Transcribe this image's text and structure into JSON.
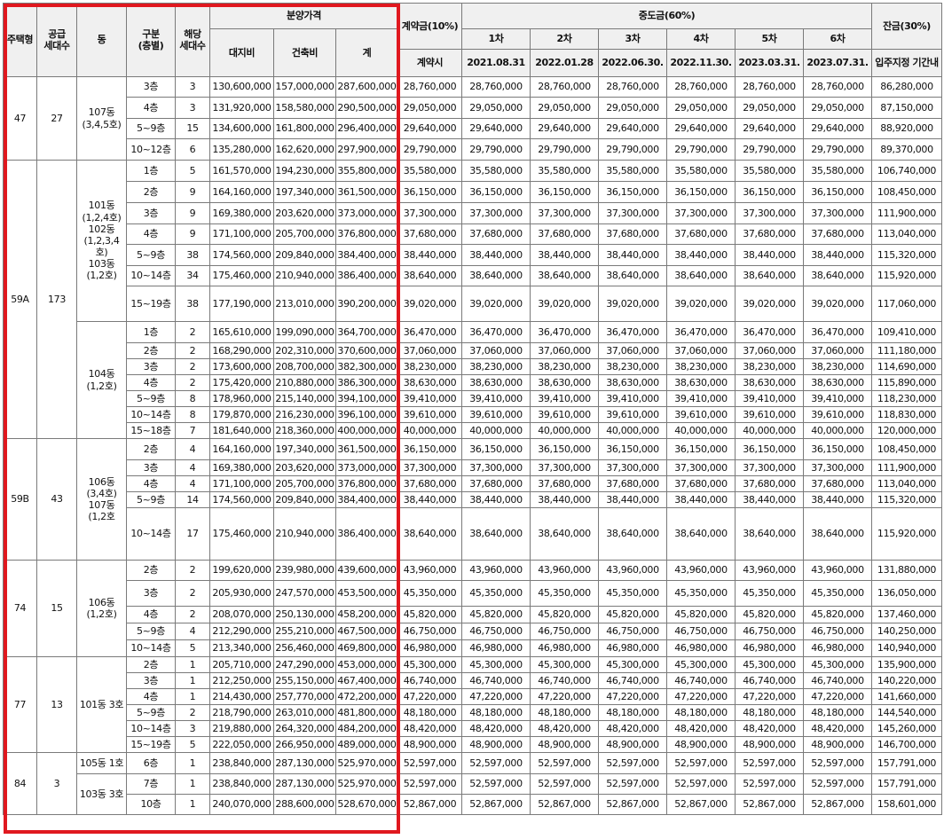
{
  "header": {
    "type": "주택형",
    "supply": "공급\n세대수",
    "dong": "동",
    "floor": "구분\n(층별)",
    "units": "해당\n세대수",
    "sale_price": "분양가격",
    "land": "대지비",
    "building": "건축비",
    "total": "계",
    "deposit": "계약금(10%)",
    "deposit_sub": "계약시",
    "middle": "중도금(60%)",
    "middle_cols": [
      {
        "label": "1차",
        "date": "2021.08.31"
      },
      {
        "label": "2차",
        "date": "2022.01.28"
      },
      {
        "label": "3차",
        "date": "2022.06.30."
      },
      {
        "label": "4차",
        "date": "2022.11.30."
      },
      {
        "label": "5차",
        "date": "2023.03.31."
      },
      {
        "label": "6차",
        "date": "2023.07.31."
      }
    ],
    "balance": "잔금(30%)",
    "balance_sub": "입주지정 기간내"
  },
  "groups": [
    {
      "type": "47",
      "supply": "27",
      "dongs": [
        {
          "label": "107동\n(3,4,5호)",
          "rows": [
            {
              "floor": "3층",
              "units": "3",
              "land": "130,600,000",
              "building": "157,000,000",
              "total": "287,600,000",
              "deposit": "28,760,000",
              "middle": "28,760,000",
              "balance": "86,280,000"
            },
            {
              "floor": "4층",
              "units": "3",
              "land": "131,920,000",
              "building": "158,580,000",
              "total": "290,500,000",
              "deposit": "29,050,000",
              "middle": "29,050,000",
              "balance": "87,150,000"
            },
            {
              "floor": "5~9층",
              "units": "15",
              "land": "134,600,000",
              "building": "161,800,000",
              "total": "296,400,000",
              "deposit": "29,640,000",
              "middle": "29,640,000",
              "balance": "88,920,000"
            },
            {
              "floor": "10~12층",
              "units": "6",
              "land": "135,280,000",
              "building": "162,620,000",
              "total": "297,900,000",
              "deposit": "29,790,000",
              "middle": "29,790,000",
              "balance": "89,370,000"
            }
          ]
        }
      ]
    },
    {
      "type": "59A",
      "supply": "173",
      "dongs": [
        {
          "label": "101동\n(1,2,4호)\n102동\n(1,2,3,4\n호)\n103동\n(1,2호)",
          "rows": [
            {
              "floor": "1층",
              "units": "5",
              "land": "161,570,000",
              "building": "194,230,000",
              "total": "355,800,000",
              "deposit": "35,580,000",
              "middle": "35,580,000",
              "balance": "106,740,000"
            },
            {
              "floor": "2층",
              "units": "9",
              "land": "164,160,000",
              "building": "197,340,000",
              "total": "361,500,000",
              "deposit": "36,150,000",
              "middle": "36,150,000",
              "balance": "108,450,000"
            },
            {
              "floor": "3층",
              "units": "9",
              "land": "169,380,000",
              "building": "203,620,000",
              "total": "373,000,000",
              "deposit": "37,300,000",
              "middle": "37,300,000",
              "balance": "111,900,000"
            },
            {
              "floor": "4층",
              "units": "9",
              "land": "171,100,000",
              "building": "205,700,000",
              "total": "376,800,000",
              "deposit": "37,680,000",
              "middle": "37,680,000",
              "balance": "113,040,000"
            },
            {
              "floor": "5~9층",
              "units": "38",
              "land": "174,560,000",
              "building": "209,840,000",
              "total": "384,400,000",
              "deposit": "38,440,000",
              "middle": "38,440,000",
              "balance": "115,320,000"
            },
            {
              "floor": "10~14층",
              "units": "34",
              "land": "175,460,000",
              "building": "210,940,000",
              "total": "386,400,000",
              "deposit": "38,640,000",
              "middle": "38,640,000",
              "balance": "115,920,000"
            },
            {
              "floor": "15~19층",
              "units": "38",
              "land": "177,190,000",
              "building": "213,010,000",
              "total": "390,200,000",
              "deposit": "39,020,000",
              "middle": "39,020,000",
              "balance": "117,060,000"
            }
          ]
        },
        {
          "label": "104동\n(1,2호)",
          "rows": [
            {
              "floor": "1층",
              "units": "2",
              "land": "165,610,000",
              "building": "199,090,000",
              "total": "364,700,000",
              "deposit": "36,470,000",
              "middle": "36,470,000",
              "balance": "109,410,000"
            },
            {
              "floor": "2층",
              "units": "2",
              "land": "168,290,000",
              "building": "202,310,000",
              "total": "370,600,000",
              "deposit": "37,060,000",
              "middle": "37,060,000",
              "balance": "111,180,000"
            },
            {
              "floor": "3층",
              "units": "2",
              "land": "173,600,000",
              "building": "208,700,000",
              "total": "382,300,000",
              "deposit": "38,230,000",
              "middle": "38,230,000",
              "balance": "114,690,000"
            },
            {
              "floor": "4층",
              "units": "2",
              "land": "175,420,000",
              "building": "210,880,000",
              "total": "386,300,000",
              "deposit": "38,630,000",
              "middle": "38,630,000",
              "balance": "115,890,000"
            },
            {
              "floor": "5~9층",
              "units": "8",
              "land": "178,960,000",
              "building": "215,140,000",
              "total": "394,100,000",
              "deposit": "39,410,000",
              "middle": "39,410,000",
              "balance": "118,230,000"
            },
            {
              "floor": "10~14층",
              "units": "8",
              "land": "179,870,000",
              "building": "216,230,000",
              "total": "396,100,000",
              "deposit": "39,610,000",
              "middle": "39,610,000",
              "balance": "118,830,000"
            },
            {
              "floor": "15~18층",
              "units": "7",
              "land": "181,640,000",
              "building": "218,360,000",
              "total": "400,000,000",
              "deposit": "40,000,000",
              "middle": "40,000,000",
              "balance": "120,000,000"
            }
          ]
        }
      ]
    },
    {
      "type": "59B",
      "supply": "43",
      "dongs": [
        {
          "label": "106동\n(3,4호)\n107동\n(1,2호",
          "rows": [
            {
              "floor": "2층",
              "units": "4",
              "land": "164,160,000",
              "building": "197,340,000",
              "total": "361,500,000",
              "deposit": "36,150,000",
              "middle": "36,150,000",
              "balance": "108,450,000"
            },
            {
              "floor": "3층",
              "units": "4",
              "land": "169,380,000",
              "building": "203,620,000",
              "total": "373,000,000",
              "deposit": "37,300,000",
              "middle": "37,300,000",
              "balance": "111,900,000"
            },
            {
              "floor": "4층",
              "units": "4",
              "land": "171,100,000",
              "building": "205,700,000",
              "total": "376,800,000",
              "deposit": "37,680,000",
              "middle": "37,680,000",
              "balance": "113,040,000"
            },
            {
              "floor": "5~9층",
              "units": "14",
              "land": "174,560,000",
              "building": "209,840,000",
              "total": "384,400,000",
              "deposit": "38,440,000",
              "middle": "38,440,000",
              "balance": "115,320,000"
            },
            {
              "floor": "10~14층",
              "units": "17",
              "land": "175,460,000",
              "building": "210,940,000",
              "total": "386,400,000",
              "deposit": "38,640,000",
              "middle": "38,640,000",
              "balance": "115,920,000"
            }
          ]
        }
      ]
    },
    {
      "type": "74",
      "supply": "15",
      "dongs": [
        {
          "label": "106동\n(1,2호)",
          "rows": [
            {
              "floor": "2층",
              "units": "2",
              "land": "199,620,000",
              "building": "239,980,000",
              "total": "439,600,000",
              "deposit": "43,960,000",
              "middle": "43,960,000",
              "balance": "131,880,000"
            },
            {
              "floor": "3층",
              "units": "2",
              "land": "205,930,000",
              "building": "247,570,000",
              "total": "453,500,000",
              "deposit": "45,350,000",
              "middle": "45,350,000",
              "balance": "136,050,000"
            },
            {
              "floor": "4층",
              "units": "2",
              "land": "208,070,000",
              "building": "250,130,000",
              "total": "458,200,000",
              "deposit": "45,820,000",
              "middle": "45,820,000",
              "balance": "137,460,000"
            },
            {
              "floor": "5~9층",
              "units": "4",
              "land": "212,290,000",
              "building": "255,210,000",
              "total": "467,500,000",
              "deposit": "46,750,000",
              "middle": "46,750,000",
              "balance": "140,250,000"
            },
            {
              "floor": "10~14층",
              "units": "5",
              "land": "213,340,000",
              "building": "256,460,000",
              "total": "469,800,000",
              "deposit": "46,980,000",
              "middle": "46,980,000",
              "balance": "140,940,000"
            }
          ]
        }
      ]
    },
    {
      "type": "77",
      "supply": "13",
      "dongs": [
        {
          "label": "101동 3호",
          "rows": [
            {
              "floor": "2층",
              "units": "1",
              "land": "205,710,000",
              "building": "247,290,000",
              "total": "453,000,000",
              "deposit": "45,300,000",
              "middle": "45,300,000",
              "balance": "135,900,000"
            },
            {
              "floor": "3층",
              "units": "1",
              "land": "212,250,000",
              "building": "255,150,000",
              "total": "467,400,000",
              "deposit": "46,740,000",
              "middle": "46,740,000",
              "balance": "140,220,000"
            },
            {
              "floor": "4층",
              "units": "1",
              "land": "214,430,000",
              "building": "257,770,000",
              "total": "472,200,000",
              "deposit": "47,220,000",
              "middle": "47,220,000",
              "balance": "141,660,000"
            },
            {
              "floor": "5~9층",
              "units": "2",
              "land": "218,790,000",
              "building": "263,010,000",
              "total": "481,800,000",
              "deposit": "48,180,000",
              "middle": "48,180,000",
              "balance": "144,540,000"
            },
            {
              "floor": "10~14층",
              "units": "3",
              "land": "219,880,000",
              "building": "264,320,000",
              "total": "484,200,000",
              "deposit": "48,420,000",
              "middle": "48,420,000",
              "balance": "145,260,000"
            },
            {
              "floor": "15~19층",
              "units": "5",
              "land": "222,050,000",
              "building": "266,950,000",
              "total": "489,000,000",
              "deposit": "48,900,000",
              "middle": "48,900,000",
              "balance": "146,700,000"
            }
          ]
        }
      ]
    },
    {
      "type": "84",
      "supply": "3",
      "dongs": [
        {
          "label": "105동 1호",
          "rows": [
            {
              "floor": "6층",
              "units": "1",
              "land": "238,840,000",
              "building": "287,130,000",
              "total": "525,970,000",
              "deposit": "52,597,000",
              "middle": "52,597,000",
              "balance": "157,791,000"
            }
          ]
        },
        {
          "label": "103동 3호",
          "rows": [
            {
              "floor": "7층",
              "units": "1",
              "land": "238,840,000",
              "building": "287,130,000",
              "total": "525,970,000",
              "deposit": "52,597,000",
              "middle": "52,597,000",
              "balance": "157,791,000"
            },
            {
              "floor": "10층",
              "units": "1",
              "land": "240,070,000",
              "building": "288,600,000",
              "total": "528,670,000",
              "deposit": "52,867,000",
              "middle": "52,867,000",
              "balance": "158,601,000"
            }
          ]
        }
      ]
    }
  ]
}
